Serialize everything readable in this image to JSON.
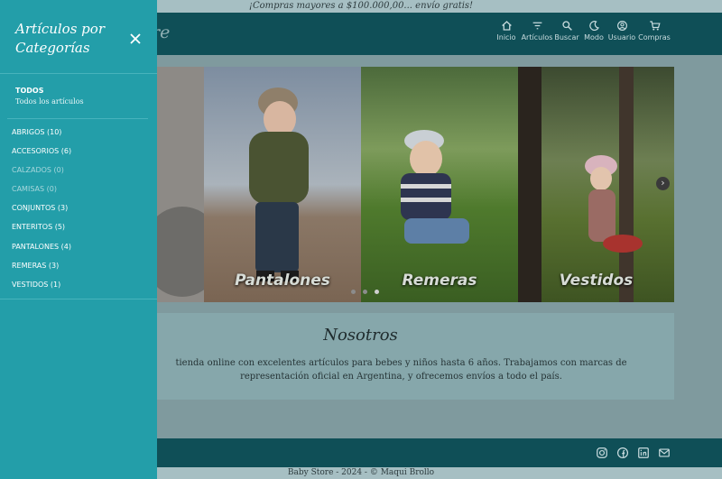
{
  "banner": {
    "text": "¡Compras mayores a $100.000,00... envío gratis!"
  },
  "brand": {
    "visible_text": "re"
  },
  "nav": [
    {
      "label": "Inicio",
      "icon": "home-icon"
    },
    {
      "label": "Artículos",
      "icon": "filter-icon"
    },
    {
      "label": "Buscar",
      "icon": "search-icon"
    },
    {
      "label": "Modo",
      "icon": "moon-icon"
    },
    {
      "label": "Usuario",
      "icon": "user-icon"
    },
    {
      "label": "Compras",
      "icon": "cart-icon"
    }
  ],
  "carousel": {
    "slides": [
      {
        "label": ""
      },
      {
        "label": "Pantalones"
      },
      {
        "label": "Remeras"
      },
      {
        "label": "Vestidos"
      }
    ],
    "indicators": 3,
    "active_indicator": 3,
    "next_icon": "chevron-right-icon"
  },
  "about": {
    "title": "Nosotros",
    "text": "tienda online con excelentes artículos para bebes y niños hasta 6 años. Trabajamos con marcas de representación oficial en Argentina, y ofrecemos envíos a todo el país."
  },
  "footer": {
    "icons": [
      "instagram-icon",
      "facebook-icon",
      "linkedin-icon",
      "mail-icon"
    ],
    "copyright": "Baby Store - 2024 - © Maqui Brollo"
  },
  "sidebar": {
    "title": "Artículos por Categorías",
    "close_icon": "close-icon",
    "all": {
      "heading": "TODOS",
      "subtitle": "Todos los artículos"
    },
    "categories": [
      {
        "label": "ABRIGOS (10)",
        "enabled": true
      },
      {
        "label": "ACCESORIOS (6)",
        "enabled": true
      },
      {
        "label": "CALZADOS (0)",
        "enabled": false
      },
      {
        "label": "CAMISAS (0)",
        "enabled": false
      },
      {
        "label": "CONJUNTOS (3)",
        "enabled": true
      },
      {
        "label": "ENTERITOS (5)",
        "enabled": true
      },
      {
        "label": "PANTALONES (4)",
        "enabled": true
      },
      {
        "label": "REMERAS (3)",
        "enabled": true
      },
      {
        "label": "VESTIDOS (1)",
        "enabled": true
      }
    ]
  },
  "colors": {
    "sidebar": "#239ea9",
    "navbar": "#0f4f57",
    "backdrop": "#7f9a9e"
  }
}
